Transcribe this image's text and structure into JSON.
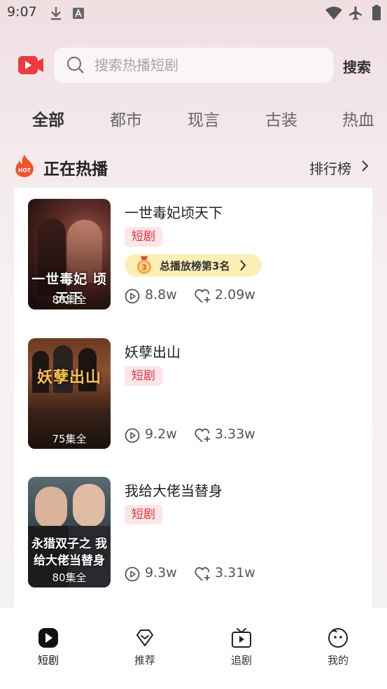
{
  "status_bar": {
    "time": "9:07"
  },
  "search": {
    "placeholder": "搜索热播短剧",
    "button_label": "搜索"
  },
  "tabs": [
    {
      "label": "全部",
      "active": true
    },
    {
      "label": "都市",
      "active": false
    },
    {
      "label": "现言",
      "active": false
    },
    {
      "label": "古装",
      "active": false
    },
    {
      "label": "热血",
      "active": false
    }
  ],
  "section": {
    "hot_badge": "HOT",
    "title": "正在热播",
    "ranking_label": "排行榜"
  },
  "dramas": [
    {
      "title": "一世毒妃顷天下",
      "poster_title": "一世毒妃 顷天下",
      "episodes": "80集全",
      "tag": "短剧",
      "rank_medal": "3",
      "rank_text": "总播放榜第3名",
      "plays": "8.8w",
      "likes": "2.09w"
    },
    {
      "title": "妖孽出山",
      "poster_title": "妖孽出山",
      "episodes": "75集全",
      "tag": "短剧",
      "plays": "9.2w",
      "likes": "3.33w"
    },
    {
      "title": "我给大佬当替身",
      "poster_title": "永猎双子之 我给大佬当替身",
      "episodes": "80集全",
      "tag": "短剧",
      "plays": "9.3w",
      "likes": "3.31w"
    }
  ],
  "bottom_nav": [
    {
      "label": "短剧",
      "icon": "play-icon",
      "active": true
    },
    {
      "label": "推荐",
      "icon": "recommend-icon",
      "active": false
    },
    {
      "label": "追剧",
      "icon": "tv-icon",
      "active": false
    },
    {
      "label": "我的",
      "icon": "profile-icon",
      "active": false
    }
  ],
  "colors": {
    "accent": "#e8343c",
    "tag_bg": "#fde6e8",
    "rank_bg": "#fbefb5"
  }
}
